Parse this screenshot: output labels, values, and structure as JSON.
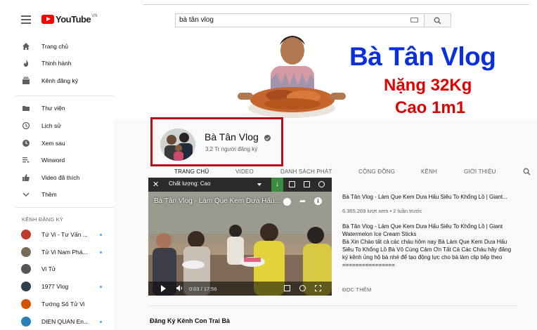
{
  "topbar": {
    "logo_text": "YouTube",
    "logo_region": "VN",
    "search_value": "bà tân vlog"
  },
  "sidebar": {
    "items": [
      {
        "label": "Trang chủ",
        "icon": "home-icon"
      },
      {
        "label": "Thịnh hành",
        "icon": "flame-icon"
      },
      {
        "label": "Kênh đăng ký",
        "icon": "subscriptions-icon"
      },
      {
        "label": "Thư viện",
        "icon": "folder-icon"
      },
      {
        "label": "Lịch sử",
        "icon": "history-icon"
      },
      {
        "label": "Xem sau",
        "icon": "clock-icon"
      },
      {
        "label": "Winword",
        "icon": "playlist-icon"
      },
      {
        "label": "Video đã thích",
        "icon": "thumbs-up-icon"
      },
      {
        "label": "Thêm",
        "icon": "chevron-down-icon"
      }
    ],
    "section_title": "KÊNH ĐĂNG KÝ",
    "subscriptions": [
      {
        "label": "Tứ Vi - Tư Vấn ...",
        "color": "#c0392b"
      },
      {
        "label": "Tử Vi Nam Phá...",
        "color": "#7a6b55"
      },
      {
        "label": "Vi Tử",
        "color": "#555555"
      },
      {
        "label": "1977 Vlog",
        "color": "#2c3e50"
      },
      {
        "label": "Tướng Số Tử Vi",
        "color": "#d35400"
      },
      {
        "label": "DIEN QUAN En...",
        "color": "#2980b9"
      }
    ]
  },
  "banner": {
    "title": "Bà Tân Vlog",
    "line2": "Nặng 32Kg",
    "line3": "Cao 1m1"
  },
  "channel": {
    "name": "Bà Tân Vlog",
    "subscribers": "3,2 Tr người đăng ký"
  },
  "tabs": [
    "TRANG CHỦ",
    "VIDEO",
    "DANH SÁCH PHÁT",
    "CỘNG ĐỒNG",
    "KÊNH",
    "GIỚI THIỆU"
  ],
  "player": {
    "quality_label": "Chất lượng: Cao",
    "overlay_title": "Bà Tân Vlog - Làm Que Kem Dưa Hấu...",
    "time": "0:03 / 17:56"
  },
  "video": {
    "title": "Bà Tân Vlog - Làm Que Kem Dưa Hấu Siêu To Khổng Lồ | Giant...",
    "meta": "6.365.269 lượt xem • 2 tuần trước",
    "description": "Bà Tân Vlog - Làm Que Kem Dưa Hấu Siêu To Khổng Lồ | Giant Watermelon Ice Cream Sticks\nBà Xin Chào tất cả các cháu hôm nay Bà Làm Que Kem Dưa Hấu Siêu To Khổng Lồ Bà Vô Cùng Cảm Ơn Tất Cả Các Cháu hãy đăng ký kênh ủng hộ bà nhé để tạo động lực cho bà làm clip tiếp theo\n================",
    "more": "ĐỌC THÊM"
  },
  "section_title": "Đăng Ký Kênh Con Trai Bà",
  "colors": {
    "brand_red": "#ff0000",
    "highlight": "#b5121b",
    "banner_blue": "#0a2fe0",
    "banner_red": "#e00000"
  }
}
